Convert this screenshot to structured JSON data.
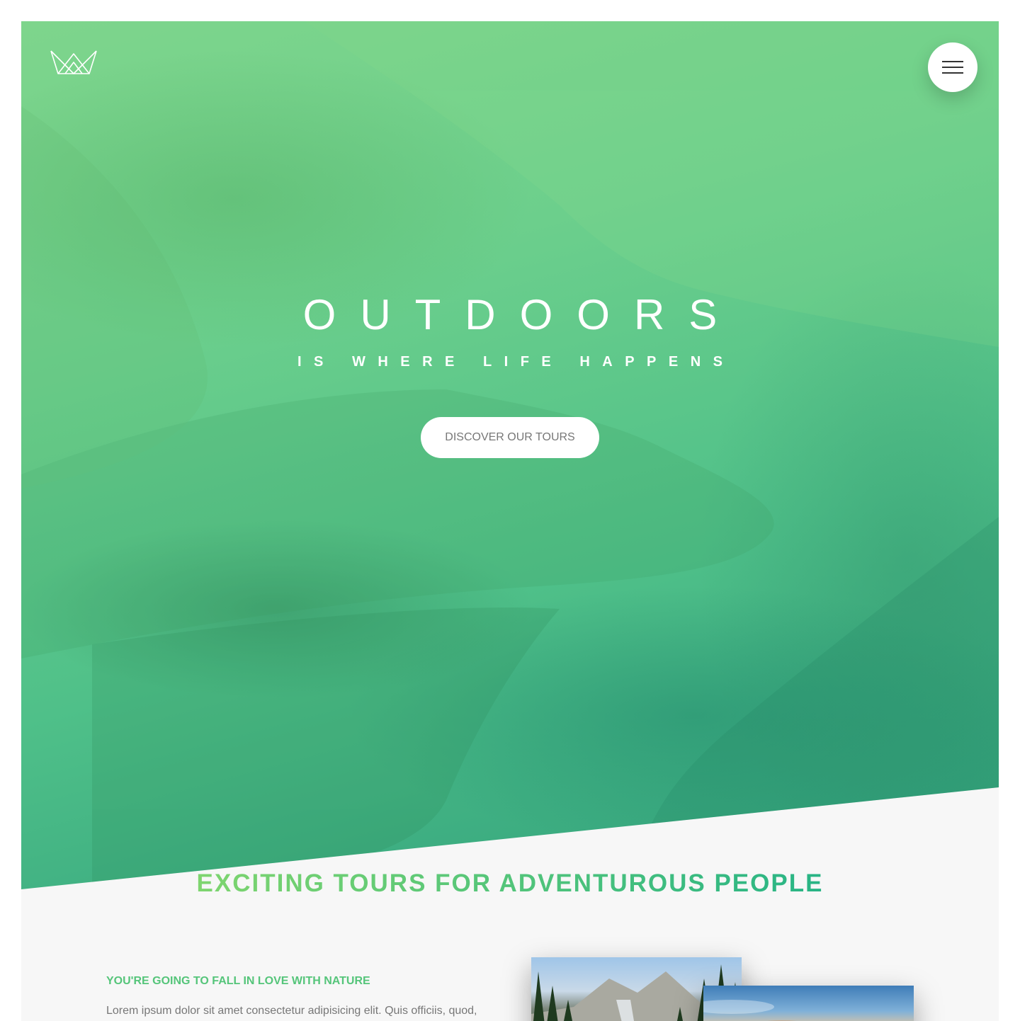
{
  "header": {
    "logo_icon": "crown-outline-icon",
    "menu_icon": "hamburger-icon"
  },
  "hero": {
    "title": "OUTDOORS",
    "subtitle": "IS WHERE LIFE HAPPENS",
    "cta_label": "DISCOVER OUR TOURS",
    "gradient_colors": [
      "#7ed56f",
      "#28b485"
    ]
  },
  "about": {
    "heading": "EXCITING TOURS FOR ADVENTUROUS PEOPLE",
    "subheading": "YOU'RE GOING TO FALL IN LOVE WITH NATURE",
    "paragraph": "Lorem ipsum dolor sit amet consectetur adipisicing elit. Quis officiis, quod,"
  },
  "colors": {
    "primary": "#55c57a",
    "primary_light": "#7ed56f",
    "primary_dark": "#28b485",
    "text": "#777777",
    "section_bg": "#f7f7f7"
  }
}
